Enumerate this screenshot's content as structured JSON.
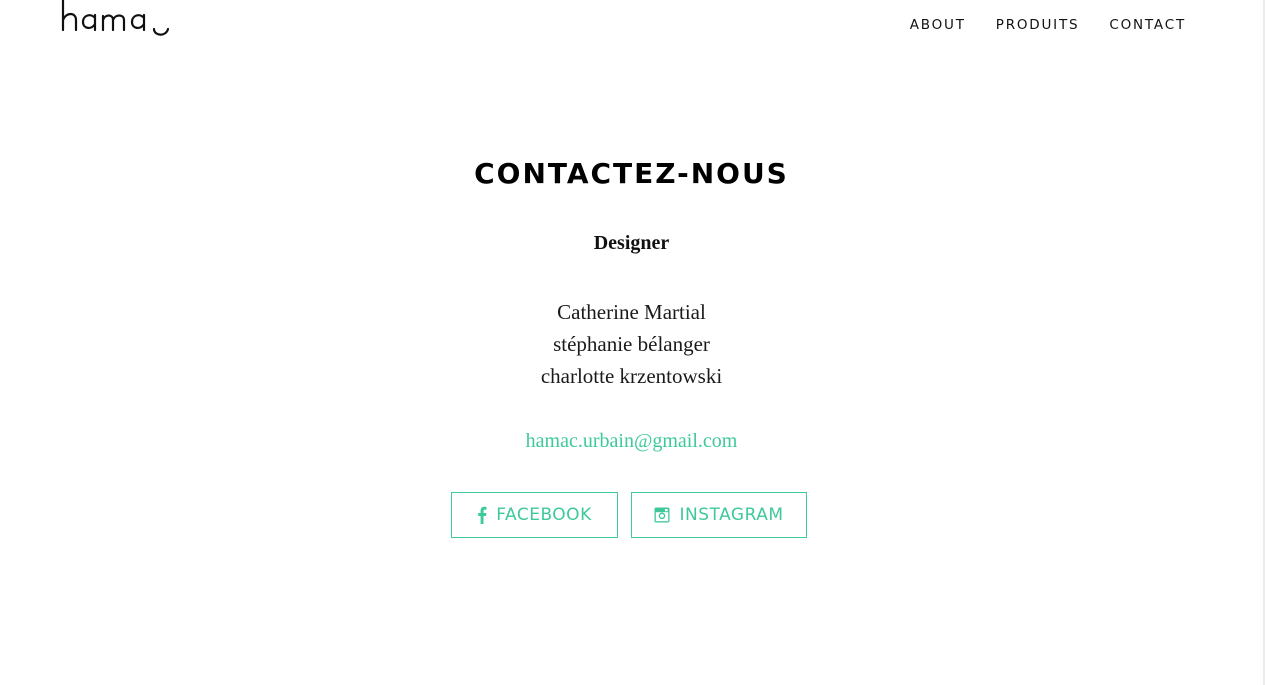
{
  "header": {
    "logo_text": "hamac",
    "nav": [
      {
        "label": "ABOUT"
      },
      {
        "label": "PRODUITS"
      },
      {
        "label": "CONTACT"
      }
    ]
  },
  "main": {
    "title": "CONTACTEZ-NOUS",
    "role": "Designer",
    "names": [
      "Catherine Martial",
      "stéphanie bélanger",
      "charlotte krzentowski"
    ],
    "email": "hamac.urbain@gmail.com",
    "social": {
      "facebook_label": "FACEBOOK",
      "instagram_label": "INSTAGRAM"
    }
  },
  "icons": {
    "facebook": "facebook-icon",
    "instagram": "instagram-icon"
  },
  "colors": {
    "accent": "#3ec99a",
    "text": "#111111",
    "background": "#ffffff"
  }
}
